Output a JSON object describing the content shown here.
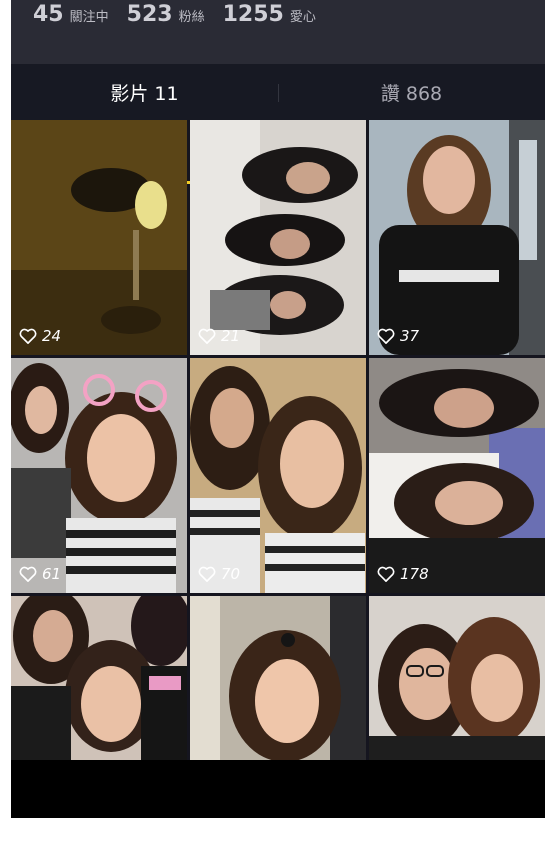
{
  "profile_stats": {
    "following_count": "45",
    "following_label": "關注中",
    "followers_count": "523",
    "followers_label": "粉絲",
    "likes_count": "1255",
    "likes_label": "愛心"
  },
  "tabs": {
    "videos_label": "影片 11",
    "liked_label": "讚 868"
  },
  "accent_color": "#f2cd27",
  "videos": [
    {
      "likes": "24"
    },
    {
      "likes": "21"
    },
    {
      "likes": "37"
    },
    {
      "likes": "61"
    },
    {
      "likes": "70"
    },
    {
      "likes": "178"
    },
    {
      "likes": ""
    },
    {
      "likes": ""
    },
    {
      "likes": ""
    }
  ]
}
